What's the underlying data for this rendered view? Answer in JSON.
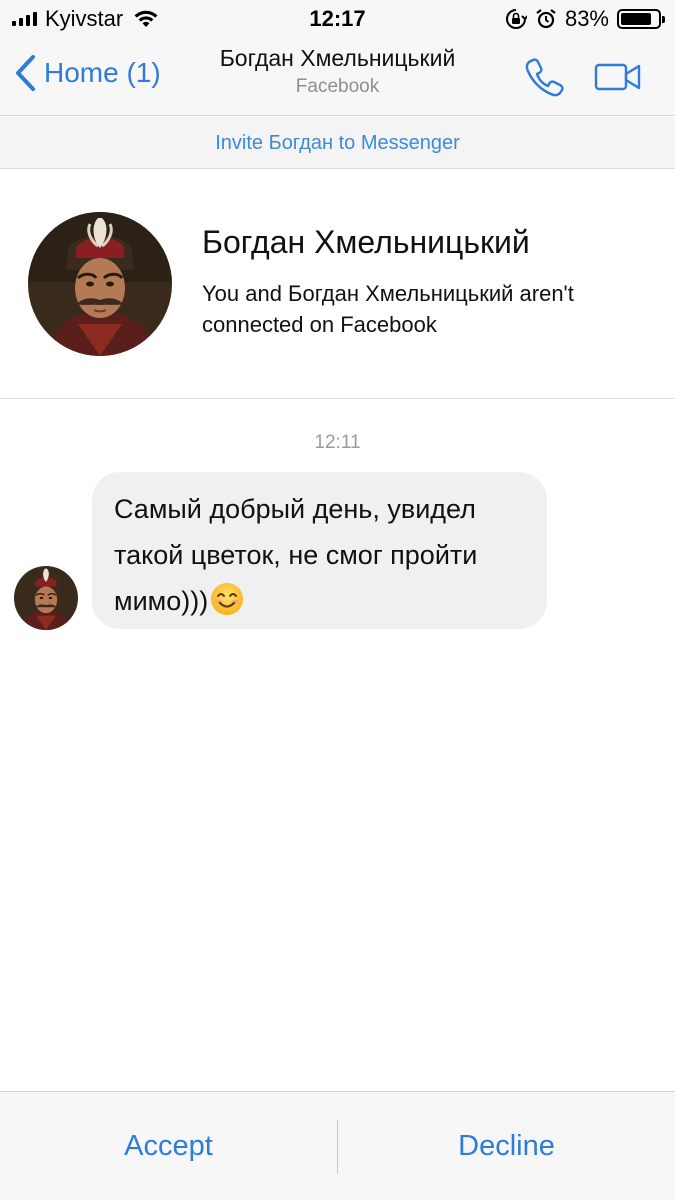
{
  "status_bar": {
    "carrier": "Kyivstar",
    "time": "12:17",
    "battery_percent": "83%",
    "battery_level": 0.83
  },
  "nav": {
    "back_label": "Home (1)",
    "title": "Богдан Хмельницький",
    "subtitle": "Facebook",
    "accent_color": "#2f7bd9"
  },
  "invite": {
    "label": "Invite Богдан to Messenger"
  },
  "profile": {
    "name": "Богдан Хмельницький",
    "note": "You and Богдан Хмельницький aren't connected on Facebook"
  },
  "conversation": {
    "timestamp": "12:11",
    "messages": [
      {
        "text": "Самый добрый день, увидел такой цветок, не смог пройти мимо)))",
        "emoji": "smiling-face-icon"
      }
    ]
  },
  "actions": {
    "accept_label": "Accept",
    "decline_label": "Decline"
  }
}
